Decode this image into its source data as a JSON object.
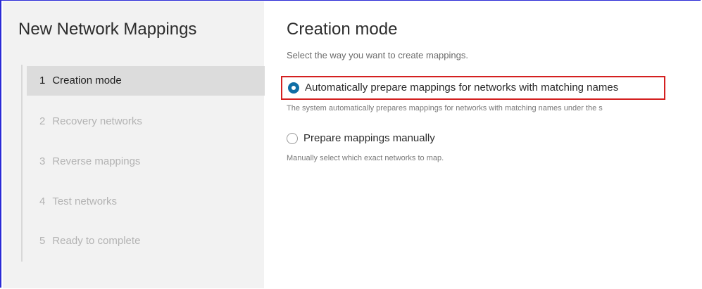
{
  "wizard": {
    "title": "New Network Mappings",
    "steps": [
      {
        "number": "1",
        "label": "Creation mode",
        "state": "active"
      },
      {
        "number": "2",
        "label": "Recovery networks",
        "state": "disabled"
      },
      {
        "number": "3",
        "label": "Reverse mappings",
        "state": "disabled"
      },
      {
        "number": "4",
        "label": "Test networks",
        "state": "disabled"
      },
      {
        "number": "5",
        "label": "Ready to complete",
        "state": "disabled"
      }
    ]
  },
  "main": {
    "title": "Creation mode",
    "description": "Select the way you want to create mappings.",
    "options": [
      {
        "label": "Automatically prepare mappings for networks with matching names",
        "help": "The system automatically prepares mappings for networks with matching names under the s",
        "selected": true,
        "highlighted": true
      },
      {
        "label": "Prepare mappings manually",
        "help": "Manually select which exact networks to map.",
        "selected": false,
        "highlighted": false
      }
    ]
  },
  "colors": {
    "accent": "#0f6ea5",
    "highlight_border": "#d42020",
    "frame_border": "#2b2bd6",
    "sidebar_bg": "#f2f2f2",
    "active_step_bg": "#dcdcdc"
  }
}
